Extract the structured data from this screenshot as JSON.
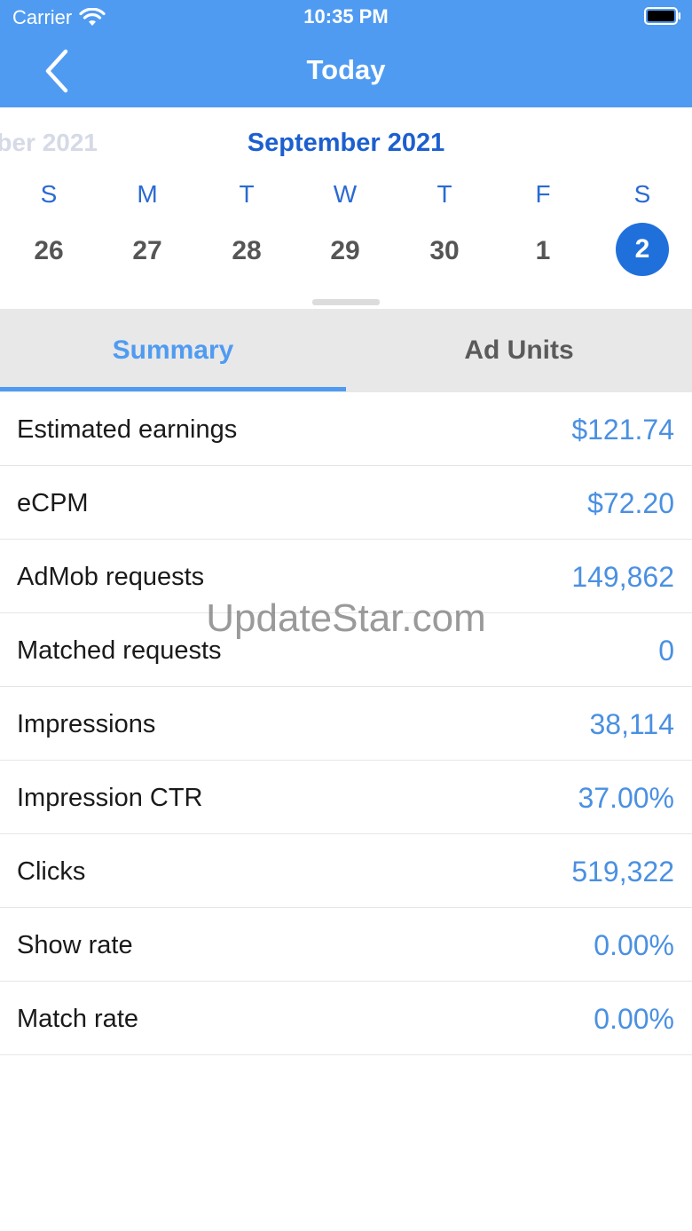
{
  "status_bar": {
    "carrier": "Carrier",
    "time": "10:35 PM"
  },
  "nav": {
    "title": "Today"
  },
  "calendar": {
    "prev_month": "ber 2021",
    "current_month": "September 2021",
    "weekdays": [
      "S",
      "M",
      "T",
      "W",
      "T",
      "F",
      "S"
    ],
    "days": [
      "26",
      "27",
      "28",
      "29",
      "30",
      "1",
      "2"
    ],
    "selected_day": "2"
  },
  "tabs": {
    "summary": "Summary",
    "ad_units": "Ad Units",
    "active": "Summary"
  },
  "metrics": [
    {
      "label": "Estimated earnings",
      "value": "$121.74"
    },
    {
      "label": "eCPM",
      "value": "$72.20"
    },
    {
      "label": "AdMob requests",
      "value": "149,862"
    },
    {
      "label": "Matched requests",
      "value": "0"
    },
    {
      "label": "Impressions",
      "value": "38,114"
    },
    {
      "label": "Impression CTR",
      "value": "37.00%"
    },
    {
      "label": "Clicks",
      "value": "519,322"
    },
    {
      "label": "Show rate",
      "value": "0.00%"
    },
    {
      "label": "Match rate",
      "value": "0.00%"
    }
  ],
  "watermark": "UpdateStar.com",
  "colors": {
    "header": "#4f9bf2",
    "accent": "#4a90e2",
    "selected_day": "#2070dc",
    "month_title": "#1c5fcf"
  }
}
